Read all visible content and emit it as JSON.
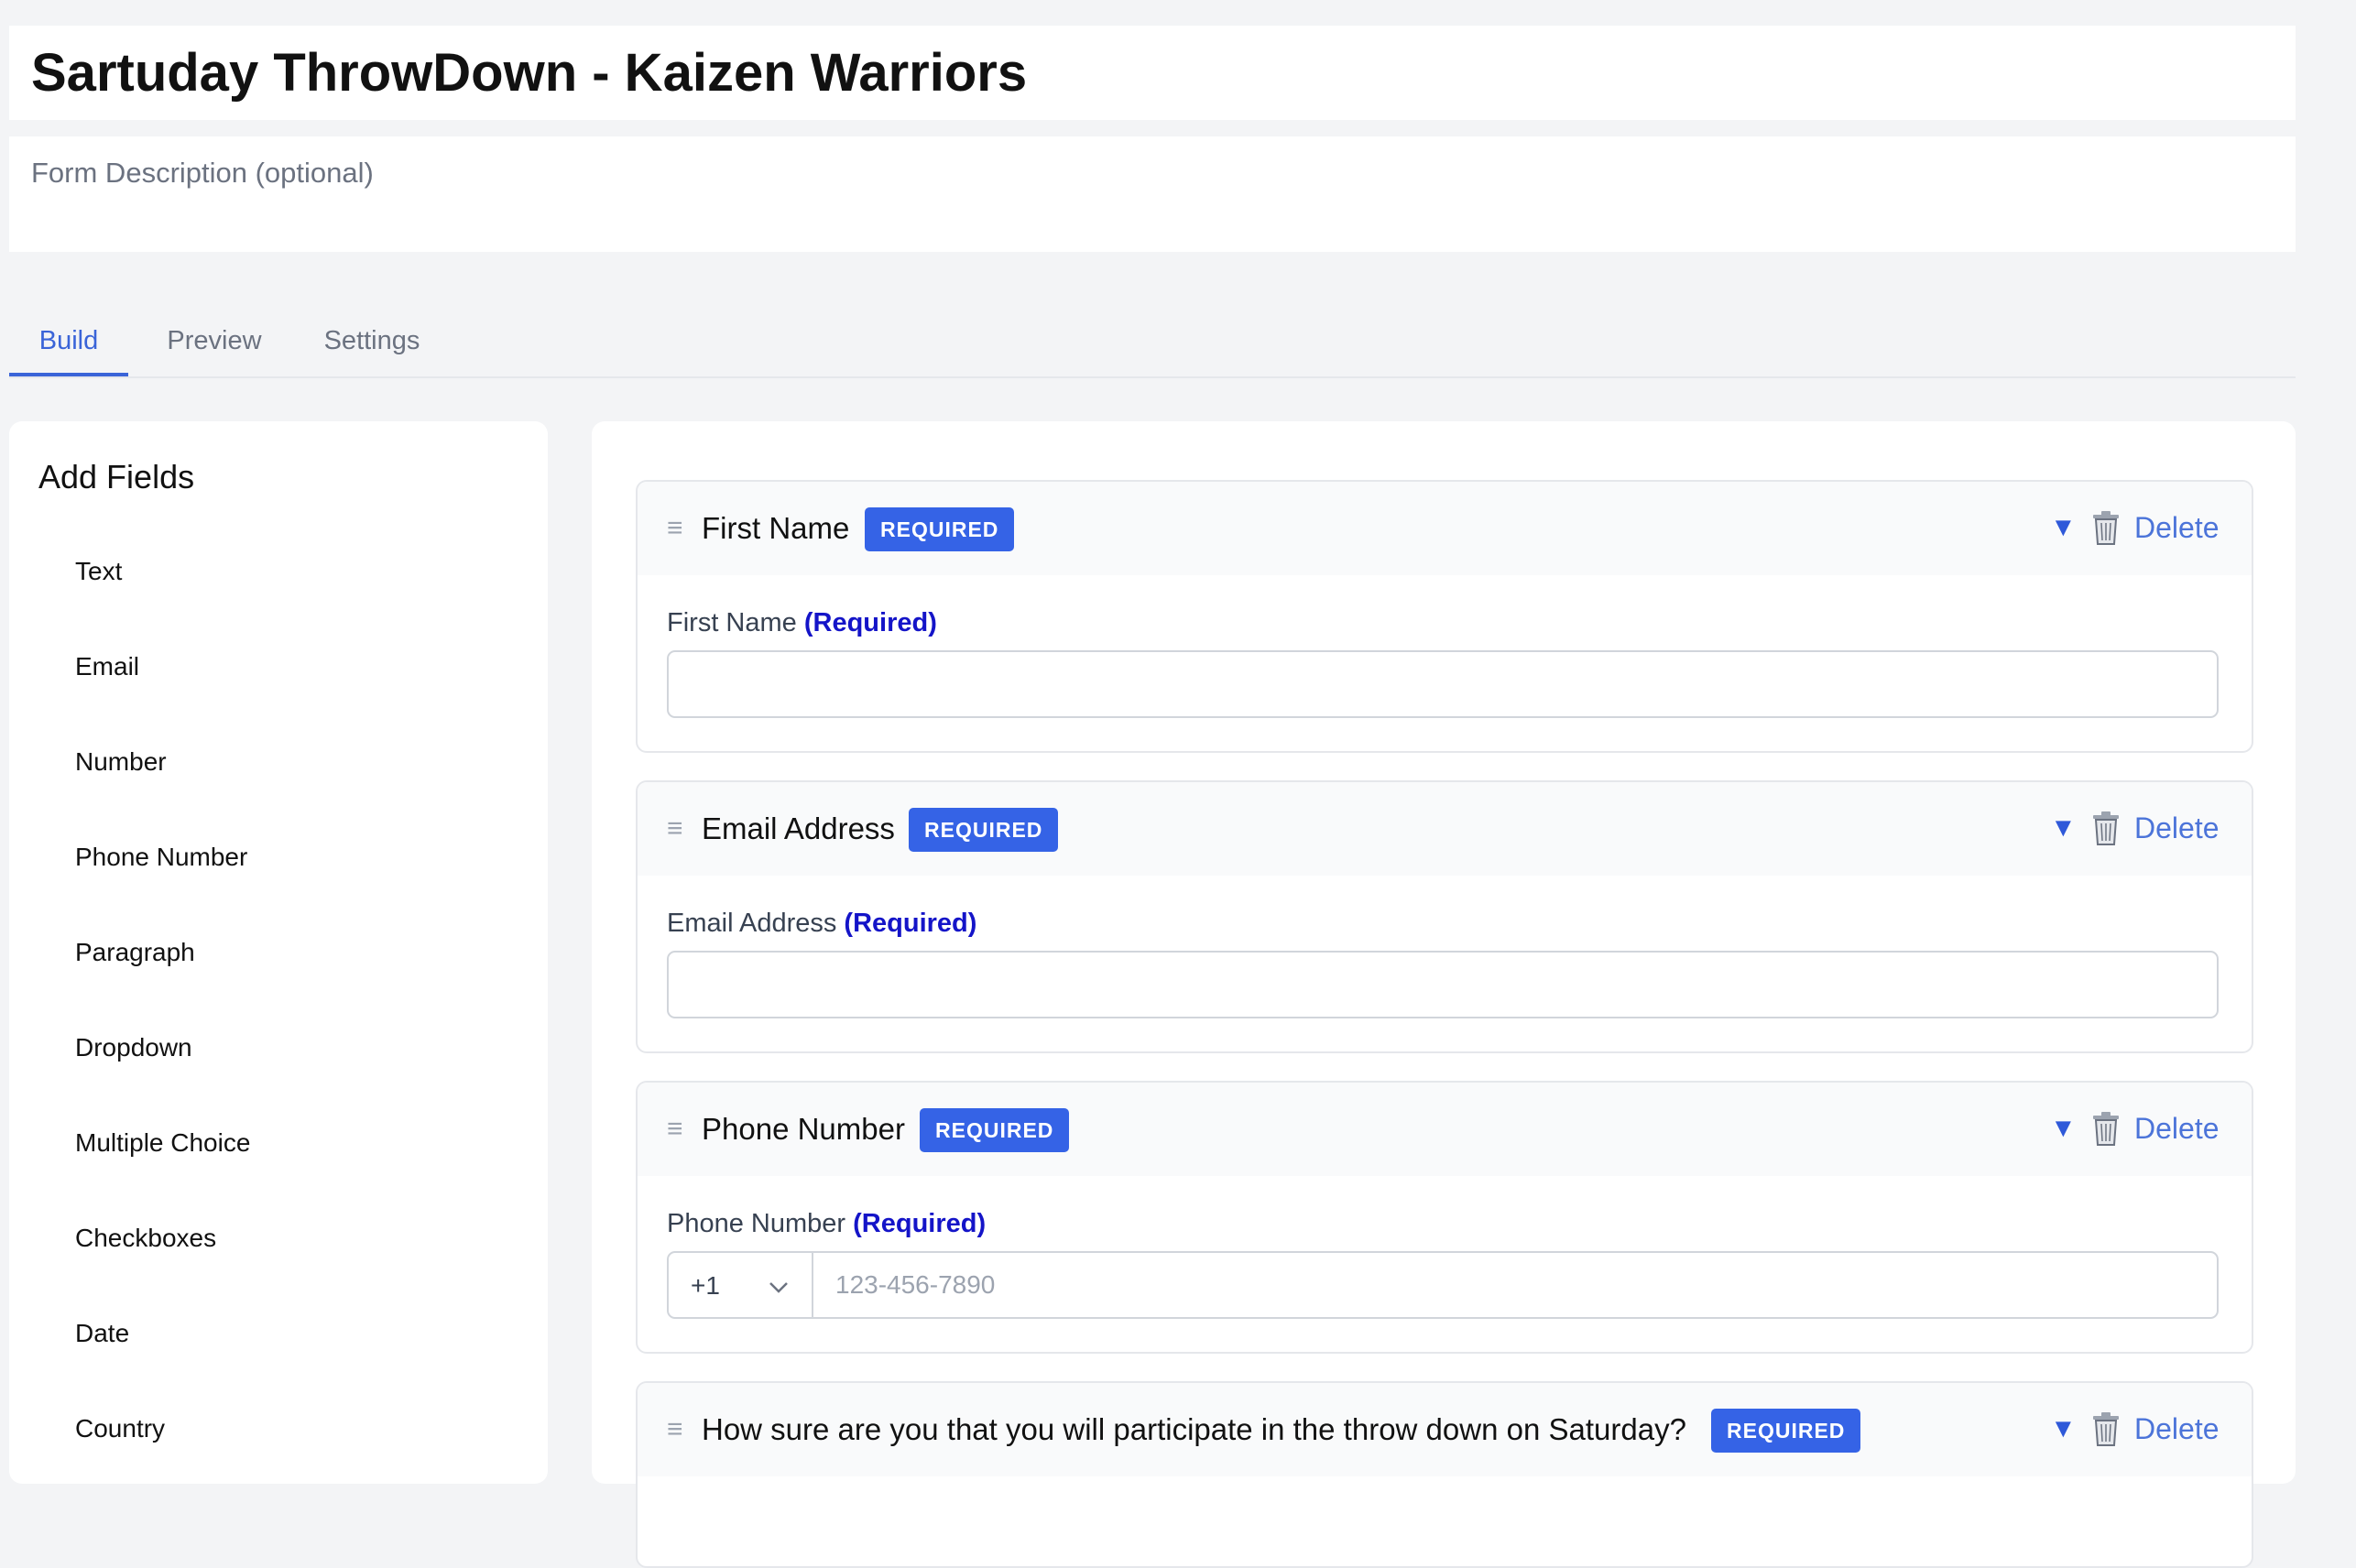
{
  "form": {
    "title": "Sartuday ThrowDown - Kaizen Warriors",
    "description_placeholder": "Form Description (optional)"
  },
  "tabs": [
    {
      "label": "Build",
      "active": true
    },
    {
      "label": "Preview",
      "active": false
    },
    {
      "label": "Settings",
      "active": false
    }
  ],
  "sidebar": {
    "title": "Add Fields",
    "field_types": [
      "Text",
      "Email",
      "Number",
      "Phone Number",
      "Paragraph",
      "Dropdown",
      "Multiple Choice",
      "Checkboxes",
      "Date",
      "Country"
    ]
  },
  "fields": [
    {
      "title": "First Name",
      "badge": "REQUIRED",
      "label": "First Name",
      "required_note": "(Required)",
      "delete_label": "Delete",
      "collapse_glyph": "▼"
    },
    {
      "title": "Email Address",
      "badge": "REQUIRED",
      "label": "Email Address",
      "required_note": "(Required)",
      "delete_label": "Delete",
      "collapse_glyph": "▼"
    },
    {
      "title": "Phone Number",
      "badge": "REQUIRED",
      "label": "Phone Number",
      "required_note": "(Required)",
      "delete_label": "Delete",
      "collapse_glyph": "▼",
      "country_code": "+1",
      "placeholder": "123-456-7890"
    },
    {
      "title": "How sure are you that you will participate in the throw down on Saturday?",
      "badge": "REQUIRED",
      "delete_label": "Delete",
      "collapse_glyph": "▼"
    }
  ],
  "icons": {
    "drag": "drag-handle-icon",
    "trash": "trash-icon",
    "collapse": "triangle-down-icon",
    "chevron": "chevron-down-icon"
  },
  "colors": {
    "accent": "#3a64d8",
    "badge": "#3563e6",
    "required_note": "#1414c8",
    "page_bg": "#f3f4f6"
  }
}
